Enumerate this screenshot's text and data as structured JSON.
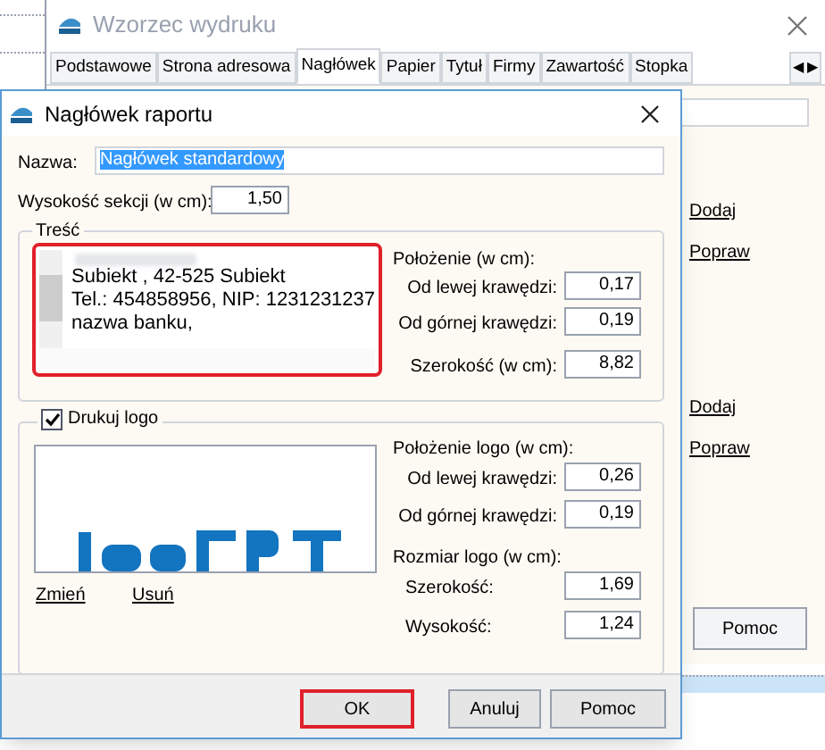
{
  "back_window": {
    "title": "Wzorzec wydruku",
    "tabs": [
      {
        "label": "Podstawowe",
        "selected": false
      },
      {
        "label": "Strona adresowa",
        "selected": false
      },
      {
        "label": "Nagłówek",
        "selected": true
      },
      {
        "label": "Papier",
        "selected": false
      },
      {
        "label": "Tytuł",
        "selected": false
      },
      {
        "label": "Firmy",
        "selected": false
      },
      {
        "label": "Zawartość",
        "selected": false
      },
      {
        "label": "Stopka",
        "selected": false
      }
    ],
    "tab_scroll": [
      "◀",
      "▶"
    ],
    "links": [
      "Dodaj",
      "Popraw",
      "Dodaj",
      "Popraw"
    ],
    "help_button": "Pomoc"
  },
  "dialog": {
    "title": "Nagłówek raportu",
    "name_label": "Nazwa:",
    "name_value": "Nagłówek standardowy",
    "height_label": "Wysokość sekcji (w cm):",
    "height_value": "1,50",
    "content_group": {
      "title": "Treść",
      "lines": [
        "Subiekt , 42-525 Subiekt",
        "Tel.: 454858956, NIP: 1231231237",
        "nazwa banku,"
      ],
      "position_label": "Położenie (w cm):",
      "fields": [
        {
          "label": "Od lewej krawędzi:",
          "value": "0,17"
        },
        {
          "label": "Od górnej krawędzi:",
          "value": "0,19"
        },
        {
          "label": "Szerokość (w cm):",
          "value": "8,82"
        }
      ]
    },
    "logo_group": {
      "title": "Drukuj logo",
      "checked": true,
      "links": [
        "Zmień",
        "Usuń"
      ],
      "position_label": "Położenie logo (w cm):",
      "position_fields": [
        {
          "label": "Od lewej krawędzi:",
          "value": "0,26"
        },
        {
          "label": "Od górnej krawędzi:",
          "value": "0,19"
        }
      ],
      "size_label": "Rozmiar logo (w cm):",
      "size_fields": [
        {
          "label": "Szerokość:",
          "value": "1,69"
        },
        {
          "label": "Wysokość:",
          "value": "1,24"
        }
      ]
    },
    "buttons": [
      {
        "label": "OK",
        "highlighted": true
      },
      {
        "label": "Anuluj",
        "highlighted": false
      },
      {
        "label": "Pomoc",
        "highlighted": false
      }
    ]
  }
}
